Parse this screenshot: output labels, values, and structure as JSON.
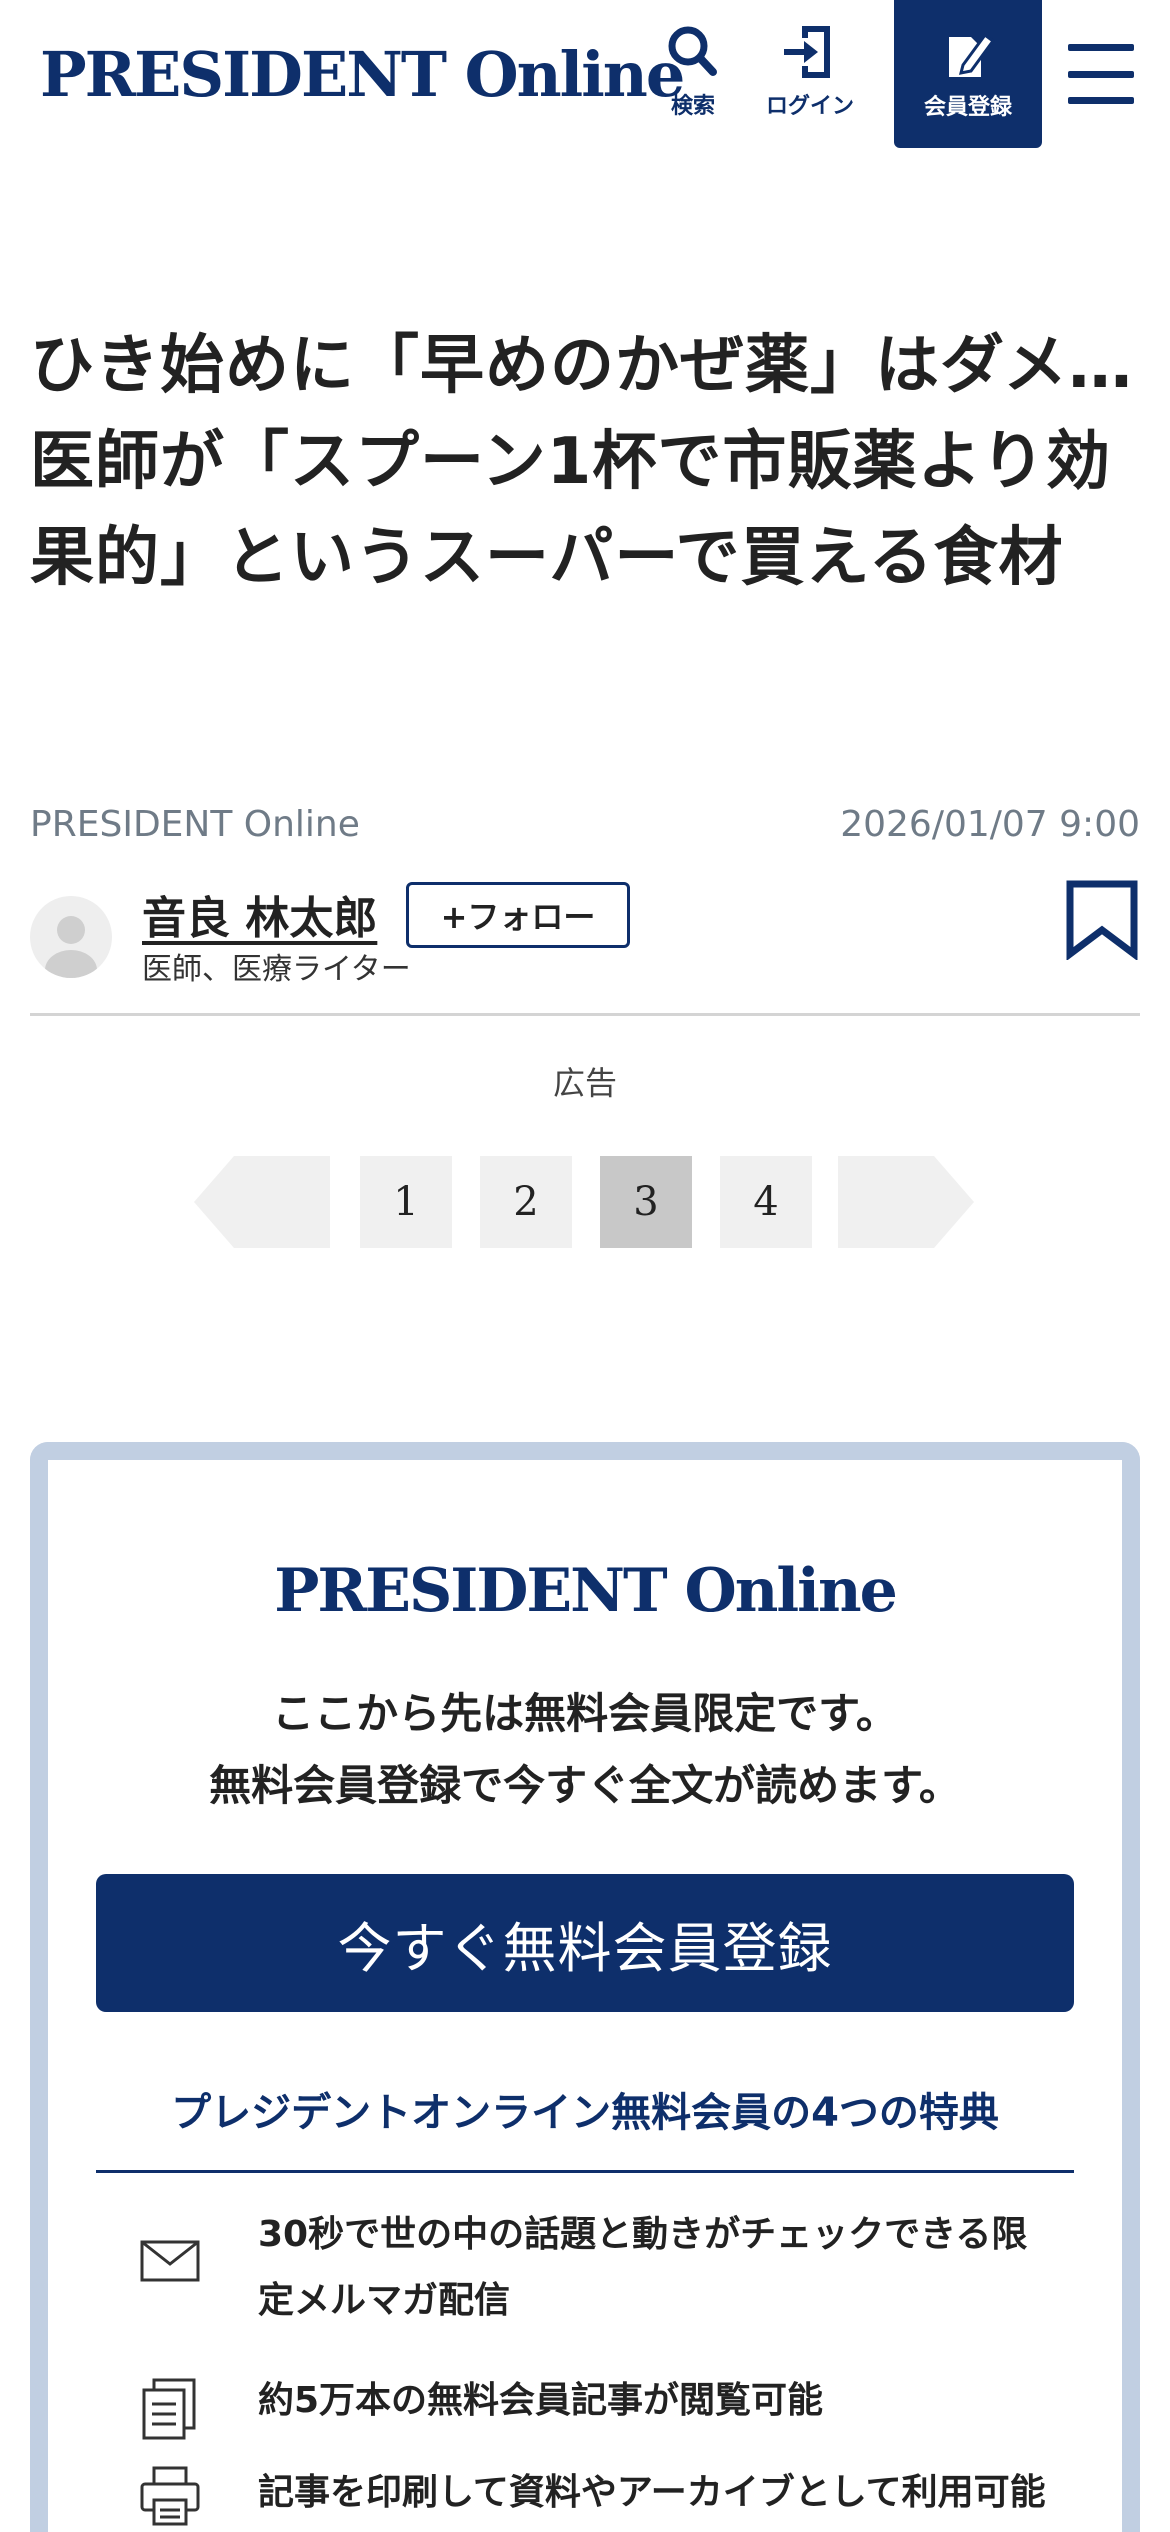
{
  "header": {
    "logo": "PRESIDENT Online",
    "search_label": "検索",
    "login_label": "ログイン",
    "register_label": "会員登録",
    "brand_color": "#0e2f6b"
  },
  "article": {
    "title": "ひき始めに「早めのかぜ薬」はダメ…医師が「スプーン1杯で市販薬より効果的」というスーパーで買える食材",
    "source": "PRESIDENT Online",
    "date": "2026/01/07 9:00",
    "author_name": "音良 林太郎",
    "follow_label": "+フォロー",
    "author_role": "医師、医療ライター"
  },
  "ad_label": "広告",
  "pager": {
    "pages": [
      "1",
      "2",
      "3",
      "4"
    ],
    "current_page": "3"
  },
  "paywall": {
    "logo": "PRESIDENT Online",
    "message_line1": "ここから先は無料会員限定です。",
    "message_line2": "無料会員登録で今すぐ全文が読めます。",
    "cta_label": "今すぐ無料会員登録",
    "benefits_title": "プレジデントオンライン無料会員の4つの特典",
    "benefits": [
      {
        "icon": "mail-icon",
        "text": "30秒で世の中の話題と動きがチェックできる限定メルマガ配信"
      },
      {
        "icon": "documents-icon",
        "text": "約5万本の無料会員記事が閲覧可能"
      },
      {
        "icon": "printer-icon",
        "text": "記事を印刷して資料やアーカイブとして利用可能"
      }
    ]
  }
}
